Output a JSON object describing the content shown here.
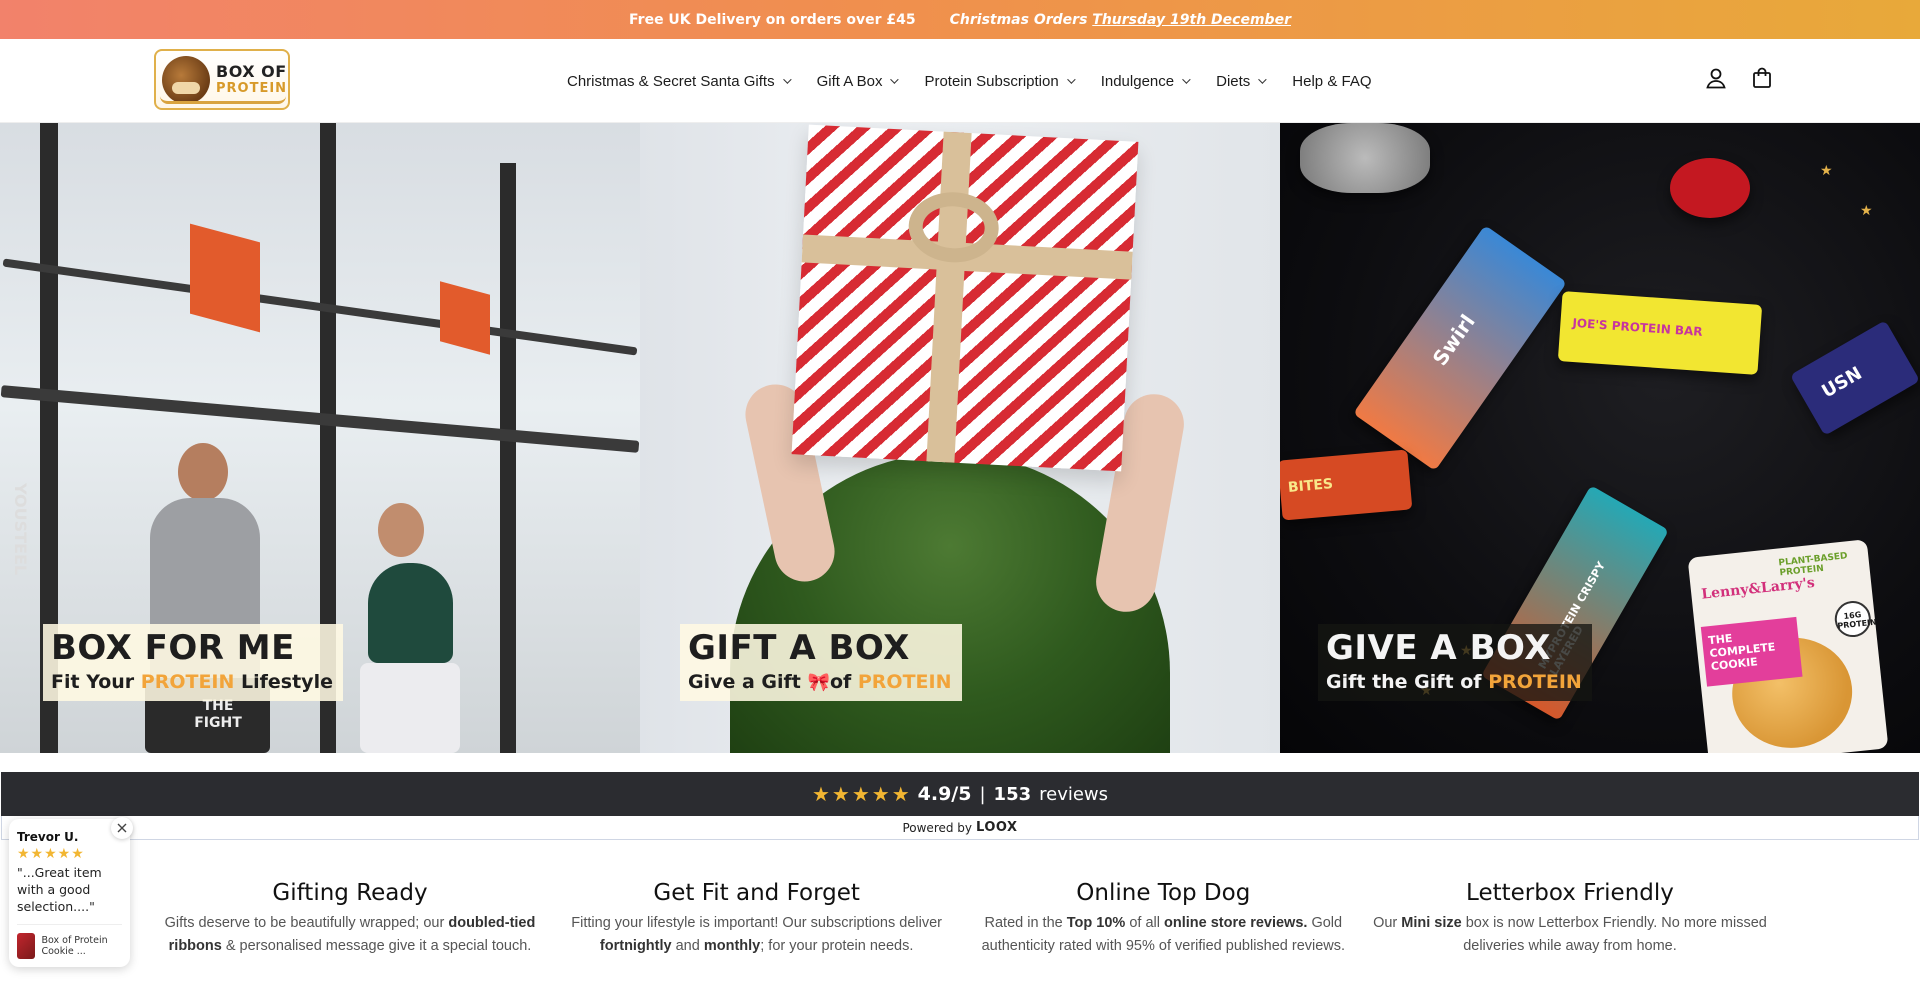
{
  "announcement": {
    "delivery": "Free UK Delivery on orders over £45",
    "christmas_prefix": "Christmas Orders",
    "christmas_date": "Thursday 19th December"
  },
  "header": {
    "logo_line1": "BOX OF",
    "logo_line2": "PROTEIN",
    "nav": [
      {
        "label": "Christmas & Secret Santa Gifts",
        "has_dropdown": true
      },
      {
        "label": "Gift A Box",
        "has_dropdown": true
      },
      {
        "label": "Protein Subscription",
        "has_dropdown": true
      },
      {
        "label": "Indulgence",
        "has_dropdown": true
      },
      {
        "label": "Diets",
        "has_dropdown": true
      },
      {
        "label": "Help & FAQ",
        "has_dropdown": false
      }
    ],
    "icons": [
      "account-icon",
      "cart-icon"
    ]
  },
  "hero": {
    "tiles": [
      {
        "title": "BOX FOR ME",
        "sub_pre": "Fit Your ",
        "sub_accent": "PROTEIN",
        "sub_post": " Lifestyle"
      },
      {
        "title": "GIFT A BOX",
        "sub_pre": "Give a Gift ",
        "bow": "🎀",
        "sub_mid": "of ",
        "sub_accent": "PROTEIN"
      },
      {
        "title": "GIVE A BOX",
        "sub_pre": "Gift the Gift of ",
        "sub_accent": "PROTEIN"
      }
    ],
    "scene_text": {
      "gym_brand": "YOUSTEEL",
      "gym_shirt": "THE FIGHT",
      "snack_1": "Swirl",
      "snack_2": "JOE'S PROTEIN BAR",
      "snack_3": "USN",
      "snack_4": "MYPROTEIN CRISPY LAYERED",
      "snack_5": "BITES",
      "cookie_brand": "Lenny&Larry's",
      "cookie_name": "THE COMPLETE COOKIE",
      "cookie_badge": "16G PROTEIN",
      "cookie_top": "PLANT-BASED PROTEIN"
    }
  },
  "reviews_bar": {
    "rating": "4.9/5",
    "separator": "|",
    "count": "153",
    "count_label": "reviews",
    "powered_by": "Powered by",
    "brand": "LOOX"
  },
  "features": [
    {
      "icon": "",
      "title": "Gifting Ready",
      "text_parts": [
        "Gifts deserve to be beautifully wrapped; our ",
        "doubled-tied ribbons",
        " & personalised message give it a special touch."
      ]
    },
    {
      "icon": "",
      "title": "Get Fit and Forget",
      "text_parts": [
        "Fitting your lifestyle is important! Our subscriptions deliver ",
        "fortnightly",
        " and ",
        "monthly",
        "; for your protein needs."
      ]
    },
    {
      "icon": "",
      "title": "Online Top Dog",
      "text_parts": [
        "Rated in the ",
        "Top 10%",
        " of all ",
        "online store reviews.",
        " Gold authenticity rated with 95% of verified published reviews."
      ]
    },
    {
      "icon": "",
      "title": "Letterbox Friendly",
      "text_parts": [
        "Our ",
        "Mini size",
        " box is now Letterbox Friendly. No more missed deliveries while away from home."
      ]
    }
  ],
  "review_popup": {
    "name": "Trevor U.",
    "stars": "★★★★★",
    "quote": "\"...Great item with a good selection....\"",
    "product": "Box of Protein Cookie ..."
  },
  "colors": {
    "announce_start": "#f2826b",
    "announce_end": "#e8a93a",
    "accent_gold": "#f2a43a",
    "star_gold": "#f2b632",
    "reviews_bg": "#2b2c30"
  }
}
